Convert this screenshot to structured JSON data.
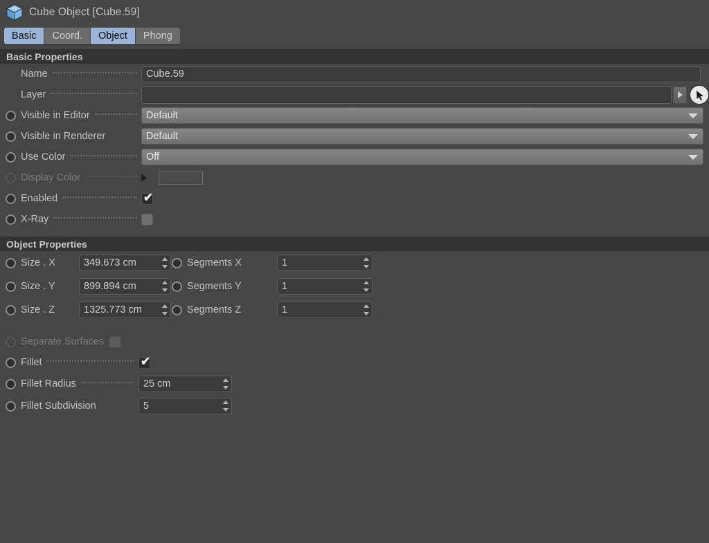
{
  "window": {
    "title": "Cube Object [Cube.59]",
    "icon": "cube-icon"
  },
  "tabs": [
    {
      "label": "Basic",
      "active": true
    },
    {
      "label": "Coord.",
      "active": false
    },
    {
      "label": "Object",
      "active": true
    },
    {
      "label": "Phong",
      "active": false
    }
  ],
  "basic": {
    "section_title": "Basic Properties",
    "name_label": "Name",
    "name_value": "Cube.59",
    "layer_label": "Layer",
    "layer_value": "",
    "visible_editor_label": "Visible in Editor",
    "visible_editor_value": "Default",
    "visible_renderer_label": "Visible in Renderer",
    "visible_renderer_value": "Default",
    "use_color_label": "Use Color",
    "use_color_value": "Off",
    "display_color_label": "Display Color",
    "enabled_label": "Enabled",
    "enabled_checked": "✔",
    "xray_label": "X-Ray"
  },
  "object": {
    "section_title": "Object Properties",
    "size_x_label": "Size . X",
    "size_x_value": "349.673 cm",
    "size_y_label": "Size . Y",
    "size_y_value": "899.894 cm",
    "size_z_label": "Size . Z",
    "size_z_value": "1325.773 cm",
    "segments_x_label": "Segments X",
    "segments_x_value": "1",
    "segments_y_label": "Segments Y",
    "segments_y_value": "1",
    "segments_z_label": "Segments Z",
    "segments_z_value": "1",
    "separate_surfaces_label": "Separate Surfaces",
    "fillet_label": "Fillet",
    "fillet_checked": "✔",
    "fillet_radius_label": "Fillet Radius",
    "fillet_radius_value": "25 cm",
    "fillet_subdivision_label": "Fillet Subdivision",
    "fillet_subdivision_value": "5"
  },
  "colors": {
    "background": "#464646",
    "section_header": "#333333",
    "tab_active": "#9ab4d8",
    "tab_inactive": "#6a6a6a",
    "field_background": "#3b3b3b",
    "dropdown": "#7b7b7b",
    "text": "#c2c2c2",
    "text_dim": "#7c7c7c",
    "cube_icon": "#7fb3e0"
  }
}
